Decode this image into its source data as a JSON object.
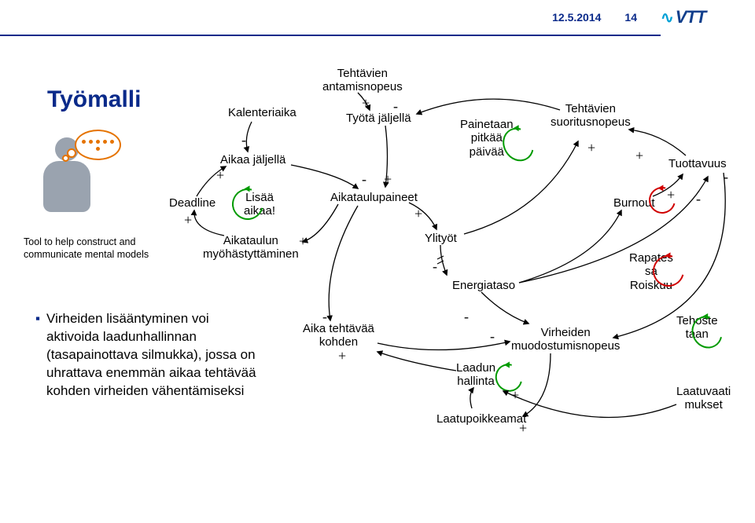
{
  "header": {
    "date": "12.5.2014",
    "page": "14",
    "logo": {
      "pulse": "∿",
      "text": "VTT"
    }
  },
  "title": "Työmalli",
  "tool_caption": "Tool  to help construct and communicate mental  models",
  "bullet": "Virheiden lisääntyminen voi aktivoida laadunhallinnan (tasapainottava silmukka), jossa on uhrattava enemmän aikaa tehtävää kohden virheiden vähentämiseksi",
  "nodes": {
    "kalenteriaika": "Kalenteriaika",
    "aikaa_jaljella": "Aikaa jäljellä",
    "deadline": "Deadline",
    "lisaa_aikaa": "Lisää\naikaa!",
    "aikataulun_myoh": "Aikataulun\nmyöhästyttäminen",
    "tehtavien_antamisnopeus": "Tehtävien\nantamisnopeus",
    "tyota_jaljella": "Työtä jäljellä",
    "aikataulupaineet": "Aikataulupaineet",
    "ylityot": "Ylityöt",
    "energiataso": "Energiataso",
    "aika_tehtavaa_kohden": "Aika tehtävää\nkohden",
    "painetaan_pitkaa_paivaa": "Painetaan\npitkää\npäivää",
    "tehtavien_suoritusnopeus": "Tehtävien\nsuoritusnopeus",
    "burnout": "Burnout",
    "tuottavuus": "Tuottavuus",
    "rapates": "Rapates\nsa\nRoiskuu",
    "virheiden_muodostumisnopeus": "Virheiden\nmuodostumisnopeus",
    "laadun_hallinta": "Laadun\nhallinta",
    "laatupoikkeamat": "Laatupoikkeamat",
    "tehostetaan": "Tehoste\ntaan",
    "laatuvaatimukset": "Laatuvaati\nmukset"
  },
  "signs": {
    "plus": "+",
    "minus": "-"
  }
}
